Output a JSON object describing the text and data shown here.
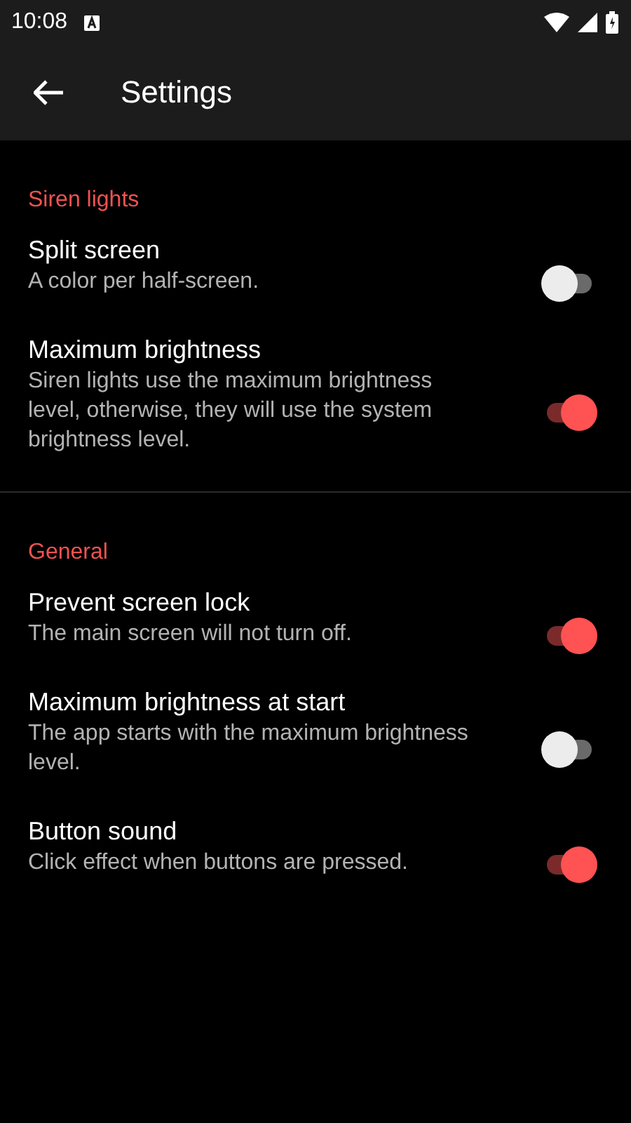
{
  "status_bar": {
    "time": "10:08"
  },
  "app_bar": {
    "title": "Settings"
  },
  "sections": [
    {
      "title": "Siren lights",
      "items": [
        {
          "title": "Split screen",
          "summary": "A color per half-screen.",
          "on": false
        },
        {
          "title": "Maximum brightness",
          "summary": "Siren lights use the maximum brightness level, otherwise, they will use the system brightness level.",
          "on": true
        }
      ]
    },
    {
      "title": "General",
      "items": [
        {
          "title": "Prevent screen lock",
          "summary": "The main screen will not turn off.",
          "on": true
        },
        {
          "title": "Maximum brightness at start",
          "summary": "The app starts with the maximum brightness level.",
          "on": false
        },
        {
          "title": "Button sound",
          "summary": "Click effect when buttons are pressed.",
          "on": true
        }
      ]
    }
  ]
}
